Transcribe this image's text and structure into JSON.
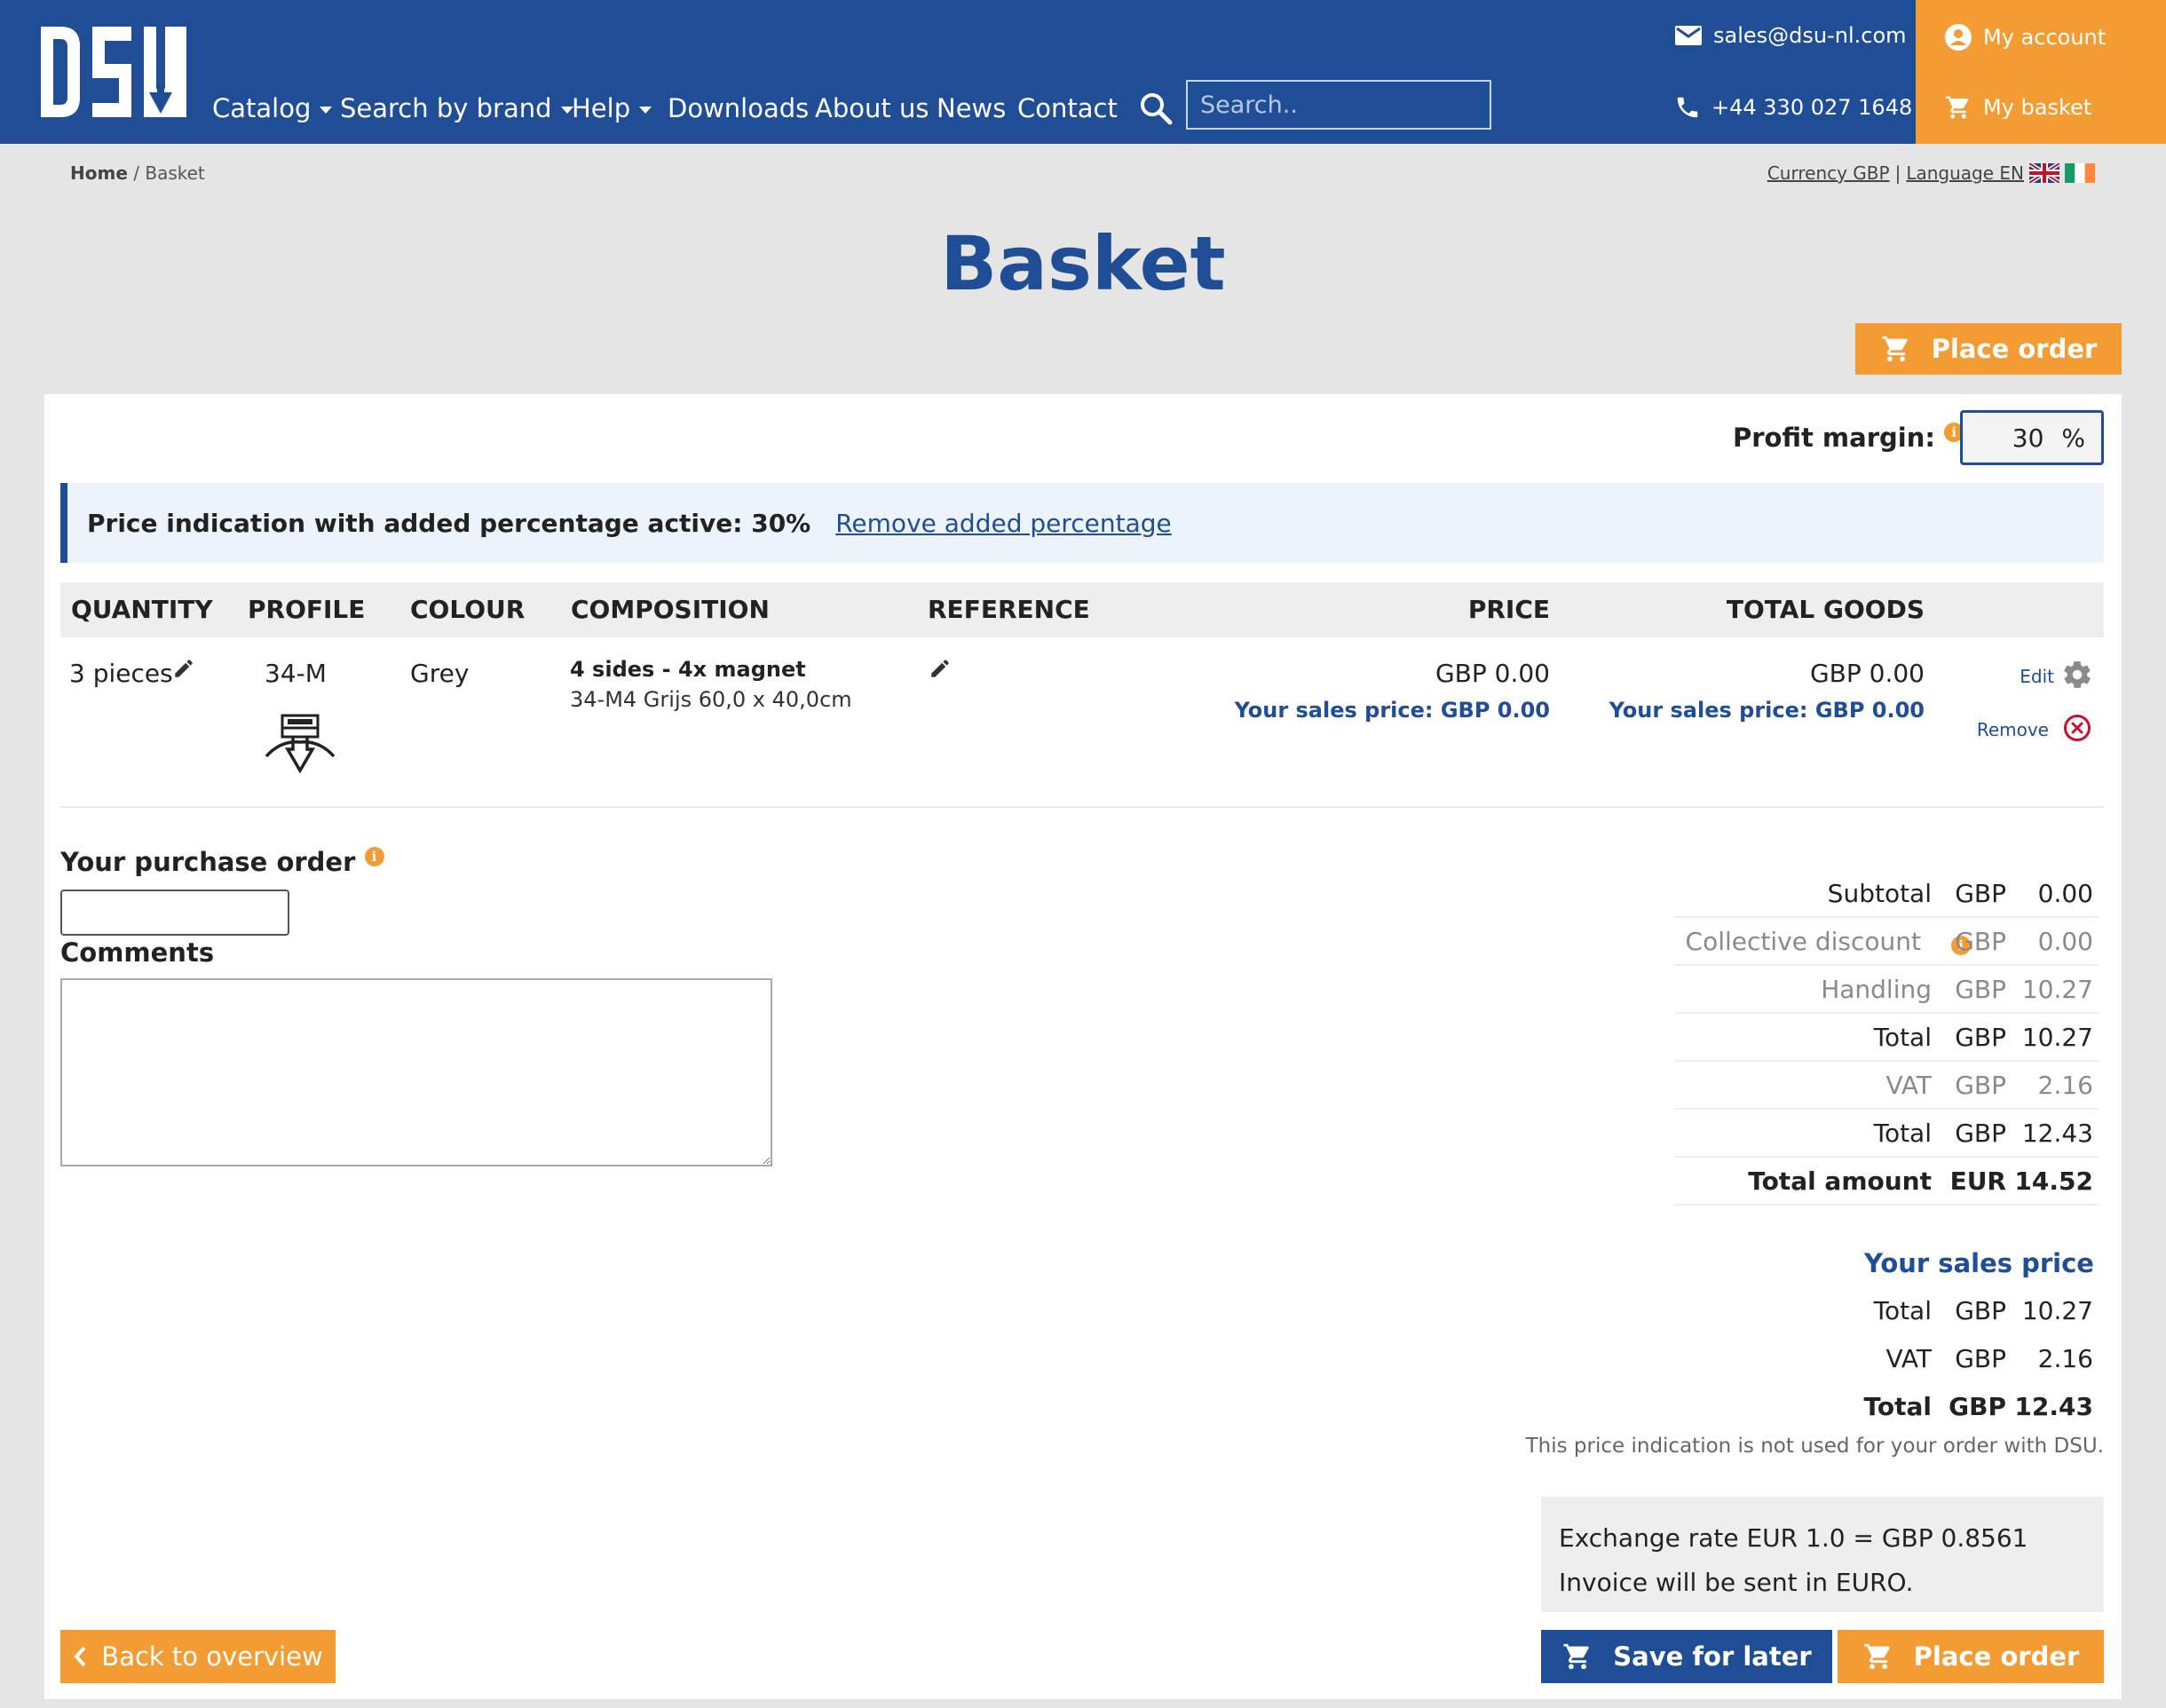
{
  "header": {
    "logo_text": "DSU",
    "nav": [
      {
        "label": "Catalog",
        "dropdown": true
      },
      {
        "label": "Search by brand",
        "dropdown": true
      },
      {
        "label": "Help",
        "dropdown": true
      },
      {
        "label": "Downloads",
        "dropdown": false
      },
      {
        "label": "About us",
        "dropdown": false
      },
      {
        "label": "News",
        "dropdown": false
      },
      {
        "label": "Contact",
        "dropdown": false
      }
    ],
    "search_placeholder": "Search..",
    "email": "sales@dsu-nl.com",
    "phone": "+44 330 027 1648",
    "my_account": "My account",
    "my_basket": "My basket"
  },
  "breadcrumb": {
    "home": "Home",
    "separator": " / ",
    "current": "Basket"
  },
  "locale": {
    "currency": "Currency GBP",
    "separator": "|",
    "language": "Language EN"
  },
  "page_title": "Basket",
  "place_order_label": "Place order",
  "profit_margin": {
    "label": "Profit margin:",
    "value": "30",
    "unit": "%"
  },
  "notice": {
    "text": "Price indication with added percentage active: 30%",
    "link": "Remove added percentage"
  },
  "table": {
    "headers": {
      "quantity": "QUANTITY",
      "profile": "PROFILE",
      "colour": "COLOUR",
      "composition": "COMPOSITION",
      "reference": "REFERENCE",
      "price": "PRICE",
      "total_goods": "TOTAL GOODS"
    },
    "row": {
      "quantity": "3 pieces",
      "profile": "34-M",
      "colour": "Grey",
      "composition_title": "4 sides - 4x magnet",
      "composition_detail": "34-M4 Grijs 60,0 x 40,0cm",
      "price": "GBP 0.00",
      "price_sales": "Your sales price: GBP 0.00",
      "total": "GBP 0.00",
      "total_sales": "Your sales price: GBP 0.00",
      "edit": "Edit",
      "remove": "Remove"
    }
  },
  "form": {
    "purchase_order_label": "Your purchase order",
    "comments_label": "Comments"
  },
  "summary": [
    {
      "label": "Subtotal",
      "currency": "GBP",
      "value": "0.00"
    },
    {
      "label": "Collective discount",
      "currency": "GBP",
      "value": "0.00"
    },
    {
      "label": "Handling",
      "currency": "GBP",
      "value": "10.27"
    },
    {
      "label": "Total",
      "currency": "GBP",
      "value": "10.27"
    },
    {
      "label": "VAT",
      "currency": "GBP",
      "value": "2.16"
    },
    {
      "label": "Total",
      "currency": "GBP",
      "value": "12.43"
    },
    {
      "label": "Total amount",
      "currency": "EUR",
      "value": "14.52"
    }
  ],
  "sales_price": {
    "heading": "Your sales price",
    "rows": [
      {
        "label": "Total",
        "currency": "GBP",
        "value": "10.27"
      },
      {
        "label": "VAT",
        "currency": "GBP",
        "value": "2.16"
      },
      {
        "label": "Total",
        "currency": "GBP",
        "value": "12.43"
      }
    ],
    "note": "This price indication is not used for your order with DSU."
  },
  "exchange": {
    "rate": "Exchange rate EUR 1.0 = GBP 0.8561",
    "invoice": "Invoice will be sent in EURO."
  },
  "buttons": {
    "back": "Back to overview",
    "save_later": "Save for later",
    "place_order": "Place order"
  },
  "colors": {
    "brand_blue": "#1f4e96",
    "accent_orange": "#f39c33",
    "remove_red": "#c8102e"
  }
}
